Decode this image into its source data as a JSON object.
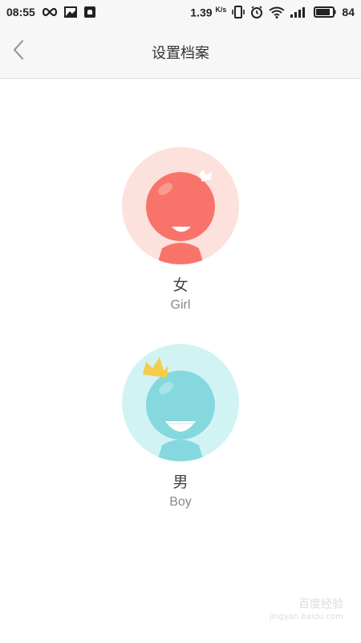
{
  "status_bar": {
    "time": "08:55",
    "network_speed": "1.39",
    "network_speed_unit": "K/s",
    "battery": "84",
    "icons": [
      "infinity-icon",
      "image-notification-icon",
      "notification-icon",
      "vibrate-icon",
      "alarm-icon",
      "wifi-icon",
      "signal-icon",
      "battery-icon"
    ]
  },
  "header": {
    "back_icon": "chevron-left-icon",
    "title": "设置档案"
  },
  "options": {
    "girl": {
      "label_cn": "女",
      "label_en": "Girl",
      "bg_color": "#fce1dd",
      "figure_color": "#f8746a"
    },
    "boy": {
      "label_cn": "男",
      "label_en": "Boy",
      "bg_color": "#d2f3f4",
      "figure_color": "#85d8de",
      "crown_color": "#f5cd4b"
    }
  },
  "watermark": {
    "line1": "百度经验",
    "line2": "jingyan.baidu.com"
  }
}
